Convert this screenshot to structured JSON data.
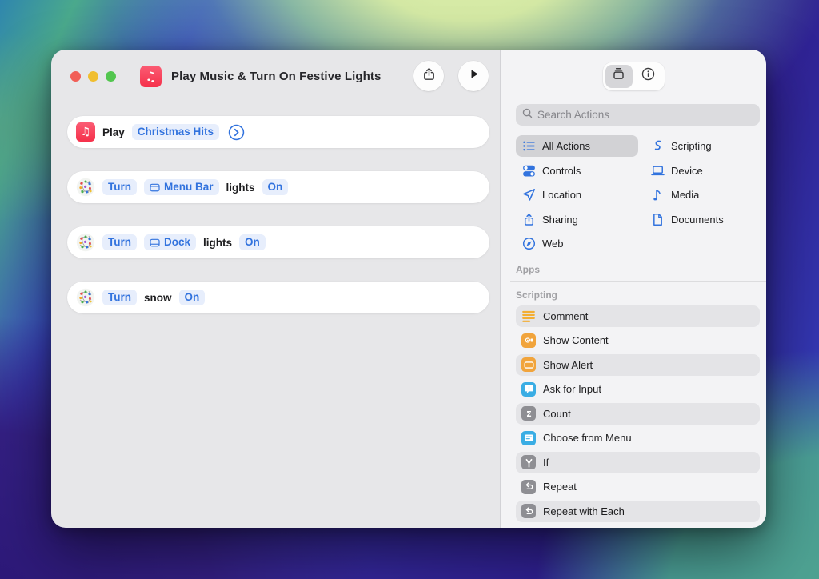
{
  "colors": {
    "accent_blue": "#3273de",
    "pill_bg": "#e7eefc",
    "traffic_red": "#f15f57",
    "traffic_yellow": "#f0be2f",
    "traffic_green": "#53c64f",
    "icon_yellow": "#f1a43c",
    "icon_cyan": "#3aade4",
    "icon_gray": "#8e8e93"
  },
  "titlebar": {
    "title": "Play Music & Turn On Festive Lights",
    "app_icon": "music-app-icon",
    "buttons": [
      "share",
      "run"
    ]
  },
  "workflow": {
    "rows": [
      {
        "icon": "music",
        "parts": [
          {
            "t": "label",
            "v": "Play"
          },
          {
            "t": "pill",
            "v": "Christmas Hits"
          },
          {
            "t": "chevron"
          }
        ]
      },
      {
        "icon": "lights",
        "parts": [
          {
            "t": "pill",
            "v": "Turn"
          },
          {
            "t": "pill-icon",
            "icon": "menubar",
            "v": "Menu Bar"
          },
          {
            "t": "label",
            "v": "lights"
          },
          {
            "t": "pill",
            "v": "On"
          }
        ]
      },
      {
        "icon": "lights",
        "parts": [
          {
            "t": "pill",
            "v": "Turn"
          },
          {
            "t": "pill-icon",
            "icon": "dock",
            "v": "Dock"
          },
          {
            "t": "label",
            "v": "lights"
          },
          {
            "t": "pill",
            "v": "On"
          }
        ]
      },
      {
        "icon": "lights",
        "parts": [
          {
            "t": "pill",
            "v": "Turn"
          },
          {
            "t": "label",
            "v": "snow"
          },
          {
            "t": "pill",
            "v": "On"
          }
        ]
      }
    ]
  },
  "library": {
    "toolbar_buttons": [
      {
        "icon": "action-library",
        "selected": true
      },
      {
        "icon": "info",
        "selected": false
      }
    ],
    "search_placeholder": "Search Actions",
    "categories_left": [
      {
        "label": "All Actions",
        "icon": "list",
        "selected": true
      },
      {
        "label": "Controls",
        "icon": "toggle",
        "selected": false
      },
      {
        "label": "Location",
        "icon": "location",
        "selected": false
      },
      {
        "label": "Sharing",
        "icon": "share",
        "selected": false
      },
      {
        "label": "Web",
        "icon": "compass",
        "selected": false
      }
    ],
    "categories_right": [
      {
        "label": "Scripting",
        "icon": "scroll",
        "selected": false
      },
      {
        "label": "Device",
        "icon": "laptop",
        "selected": false
      },
      {
        "label": "Media",
        "icon": "note",
        "selected": false
      },
      {
        "label": "Documents",
        "icon": "doc",
        "selected": false
      }
    ],
    "apps_label": "Apps",
    "group_label": "Scripting",
    "actions": [
      {
        "label": "Comment",
        "icon": "comment",
        "shaded": true
      },
      {
        "label": "Show Content",
        "icon": "show-content",
        "shaded": false
      },
      {
        "label": "Show Alert",
        "icon": "show-alert",
        "shaded": true
      },
      {
        "label": "Ask for Input",
        "icon": "ask-input",
        "shaded": false
      },
      {
        "label": "Count",
        "icon": "count",
        "shaded": true
      },
      {
        "label": "Choose from Menu",
        "icon": "choose-menu",
        "shaded": false
      },
      {
        "label": "If",
        "icon": "if",
        "shaded": true
      },
      {
        "label": "Repeat",
        "icon": "repeat",
        "shaded": false
      },
      {
        "label": "Repeat with Each",
        "icon": "repeat-each",
        "shaded": true
      },
      {
        "label": "",
        "icon": "partial",
        "shaded": false
      }
    ]
  }
}
